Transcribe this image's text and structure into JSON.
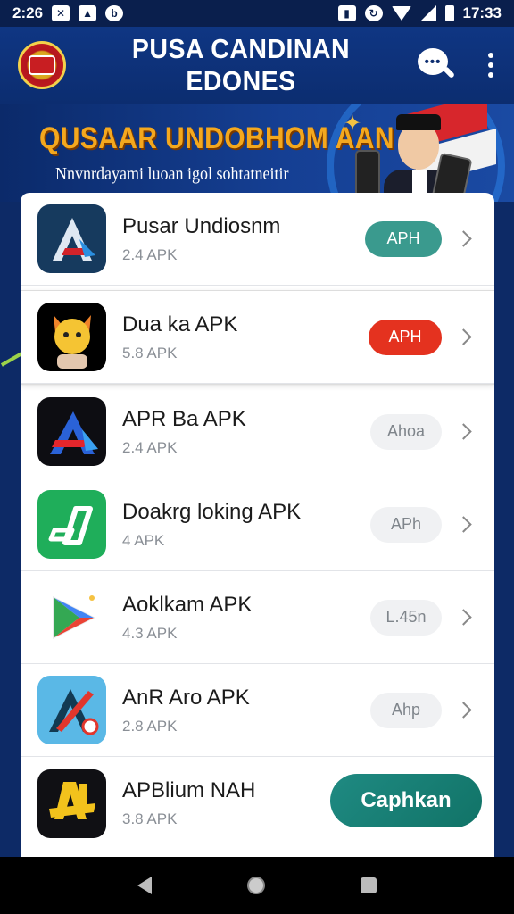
{
  "status_bar": {
    "time_left": "2:26",
    "time_right": "17:33",
    "colors": {
      "background": "#0a1f4d",
      "text": "#ffffff"
    }
  },
  "app_bar": {
    "title": "PUSA CANDINAN EDONES",
    "colors": {
      "background": "#0f3683"
    }
  },
  "banner": {
    "headline": "QUSAAR UNDOBHOM AAN",
    "subtitle": "Nnvnrdayami luoan igol sohtatneitir",
    "colors": {
      "headline": "#f4a81e",
      "subtitle": "#ffffff"
    }
  },
  "list": {
    "items": [
      {
        "name": "Pusar Undiosnm",
        "version": "2.4 APK",
        "action": "APH",
        "action_style": "teal",
        "icon": "blue-a-icon"
      },
      {
        "name": "Dua ka APK",
        "version": "5.8 APK",
        "action": "APH",
        "action_style": "red",
        "icon": "cat-icon"
      },
      {
        "name": "APR Ba APK",
        "version": "2.4 APK",
        "action": "Ahoa",
        "action_style": "gray",
        "icon": "red-blue-a-icon"
      },
      {
        "name": "Doakrg loking APK",
        "version": "4 APK",
        "action": "APh",
        "action_style": "gray",
        "icon": "green-a-icon"
      },
      {
        "name": "Aoklkam APK",
        "version": "4.3 APK",
        "action": "L.45n",
        "action_style": "gray",
        "icon": "play-store-icon"
      },
      {
        "name": "AnR Aro APK",
        "version": "2.8 APK",
        "action": "Ahp",
        "action_style": "gray",
        "icon": "teal-a-icon"
      },
      {
        "name": "APBlium NAH",
        "version": "3.8 APK",
        "action": "Caphkan",
        "action_style": "big-teal",
        "icon": "yellow-a-icon"
      }
    ]
  },
  "colors": {
    "teal": "#3a9a8e",
    "red": "#e4321f",
    "gray_pill": "#f0f1f3",
    "page_bg": "#0d2a66"
  }
}
